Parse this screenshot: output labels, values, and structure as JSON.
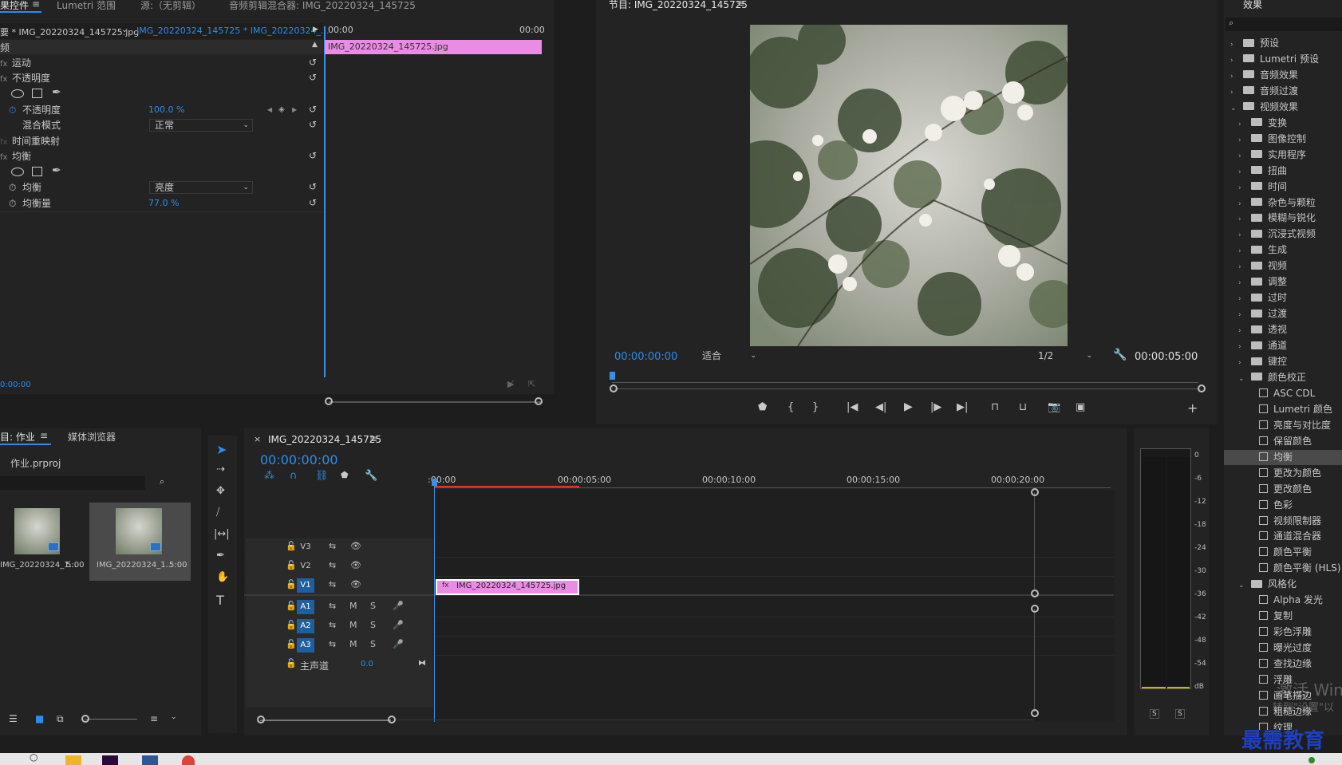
{
  "effect_controls": {
    "tabs": [
      "果控件",
      "Lumetri 范围",
      "源:（无剪辑）",
      "音频剪辑混合器: IMG_20220324_145725"
    ],
    "source_label": "要 * IMG_20220324_145725.jpg",
    "sequence_clip": "IMG_20220324_145725 * IMG_20220324_...",
    "time_start": "00:00",
    "time_end": "00:00",
    "clip_name": "IMG_20220324_145725.jpg",
    "section_header": "频",
    "rows": {
      "motion": "运动",
      "opacity_group": "不透明度",
      "opacity": "不透明度",
      "opacity_value": "100.0 %",
      "blend_mode": "混合模式",
      "blend_value": "正常",
      "time_remap": "时间重映射",
      "equalize_group": "均衡",
      "equalize": "均衡",
      "equalize_value": "亮度",
      "equalize_amount": "均衡量",
      "equalize_amount_value": "77.0 %"
    },
    "fx_label": "fx",
    "footer_time": "0:00:00"
  },
  "program": {
    "title": "节目: IMG_20220324_145725",
    "timecode": "00:00:00:00",
    "fit": "适合",
    "quality": "1/2",
    "duration": "00:00:05:00"
  },
  "project": {
    "tabs": [
      "目: 作业",
      "媒体浏览器"
    ],
    "file": "作业.prproj",
    "items": [
      {
        "name": "IMG_20220324_1...",
        "duration": "5:00"
      },
      {
        "name": "IMG_20220324_1...",
        "duration": "5:00"
      }
    ]
  },
  "timeline": {
    "tab": "IMG_20220324_145725",
    "close": "×",
    "timecode": "00:00:00:00",
    "ruler": [
      ":00:00",
      "00:00:05:00",
      "00:00:10:00",
      "00:00:15:00",
      "00:00:20:00"
    ],
    "video_tracks": [
      "V3",
      "V2",
      "V1"
    ],
    "audio_tracks": [
      "A1",
      "A2",
      "A3"
    ],
    "master_label": "主声道",
    "master_value": "0.0",
    "clip_name": "IMG_20220324_145725.jpg",
    "m": "M",
    "s": "S"
  },
  "meter": {
    "labels": [
      "0",
      "-6",
      "-12",
      "-18",
      "-24",
      "-30",
      "-36",
      "-42",
      "-48",
      "-54",
      "dB"
    ],
    "solo": [
      "S",
      "S"
    ]
  },
  "effects": {
    "title": "效果",
    "search_placeholder": "",
    "items": [
      {
        "label": "预设",
        "type": "folder",
        "level": 0,
        "expanded": false
      },
      {
        "label": "Lumetri 预设",
        "type": "folder",
        "level": 0,
        "expanded": false
      },
      {
        "label": "音频效果",
        "type": "folder",
        "level": 0,
        "expanded": false
      },
      {
        "label": "音频过渡",
        "type": "folder",
        "level": 0,
        "expanded": false
      },
      {
        "label": "视频效果",
        "type": "folder",
        "level": 0,
        "expanded": true
      },
      {
        "label": "变换",
        "type": "folder",
        "level": 1,
        "expanded": false
      },
      {
        "label": "图像控制",
        "type": "folder",
        "level": 1,
        "expanded": false
      },
      {
        "label": "实用程序",
        "type": "folder",
        "level": 1,
        "expanded": false
      },
      {
        "label": "扭曲",
        "type": "folder",
        "level": 1,
        "expanded": false
      },
      {
        "label": "时间",
        "type": "folder",
        "level": 1,
        "expanded": false
      },
      {
        "label": "杂色与颗粒",
        "type": "folder",
        "level": 1,
        "expanded": false
      },
      {
        "label": "模糊与锐化",
        "type": "folder",
        "level": 1,
        "expanded": false
      },
      {
        "label": "沉浸式视频",
        "type": "folder",
        "level": 1,
        "expanded": false
      },
      {
        "label": "生成",
        "type": "folder",
        "level": 1,
        "expanded": false
      },
      {
        "label": "视频",
        "type": "folder",
        "level": 1,
        "expanded": false
      },
      {
        "label": "调整",
        "type": "folder",
        "level": 1,
        "expanded": false
      },
      {
        "label": "过时",
        "type": "folder",
        "level": 1,
        "expanded": false
      },
      {
        "label": "过渡",
        "type": "folder",
        "level": 1,
        "expanded": false
      },
      {
        "label": "透视",
        "type": "folder",
        "level": 1,
        "expanded": false
      },
      {
        "label": "通道",
        "type": "folder",
        "level": 1,
        "expanded": false
      },
      {
        "label": "键控",
        "type": "folder",
        "level": 1,
        "expanded": false
      },
      {
        "label": "颜色校正",
        "type": "folder",
        "level": 1,
        "expanded": true
      },
      {
        "label": "ASC CDL",
        "type": "effect",
        "level": 2
      },
      {
        "label": "Lumetri 颜色",
        "type": "effect",
        "level": 2
      },
      {
        "label": "亮度与对比度",
        "type": "effect",
        "level": 2
      },
      {
        "label": "保留颜色",
        "type": "effect",
        "level": 2
      },
      {
        "label": "均衡",
        "type": "effect",
        "level": 2,
        "selected": true
      },
      {
        "label": "更改为颜色",
        "type": "effect",
        "level": 2
      },
      {
        "label": "更改颜色",
        "type": "effect",
        "level": 2
      },
      {
        "label": "色彩",
        "type": "effect",
        "level": 2
      },
      {
        "label": "视频限制器",
        "type": "effect",
        "level": 2
      },
      {
        "label": "通道混合器",
        "type": "effect",
        "level": 2
      },
      {
        "label": "颜色平衡",
        "type": "effect",
        "level": 2
      },
      {
        "label": "颜色平衡 (HLS)",
        "type": "effect",
        "level": 2
      },
      {
        "label": "风格化",
        "type": "folder",
        "level": 1,
        "expanded": true
      },
      {
        "label": "Alpha 发光",
        "type": "effect",
        "level": 2
      },
      {
        "label": "复制",
        "type": "effect",
        "level": 2
      },
      {
        "label": "彩色浮雕",
        "type": "effect",
        "level": 2
      },
      {
        "label": "曝光过度",
        "type": "effect",
        "level": 2
      },
      {
        "label": "查找边缘",
        "type": "effect",
        "level": 2
      },
      {
        "label": "浮雕",
        "type": "effect",
        "level": 2
      },
      {
        "label": "画笔描边",
        "type": "effect",
        "level": 2
      },
      {
        "label": "粗糙边缘",
        "type": "effect",
        "level": 2
      },
      {
        "label": "纹理",
        "type": "effect",
        "level": 2
      }
    ]
  },
  "watermark": {
    "activate": "激活 Win",
    "activate_sub": "转到\"设置\"以",
    "brand": "最需教育"
  },
  "colors": {
    "accent": "#2d8ceb",
    "clip": "#e98ce3",
    "playhead": "#3d8fe6",
    "panel": "#232323"
  }
}
